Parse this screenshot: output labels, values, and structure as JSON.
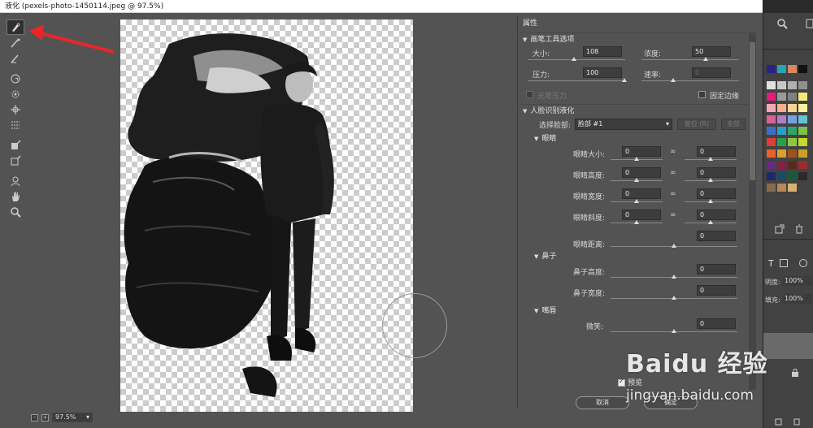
{
  "window": {
    "title": "液化 (pexels-photo-1450114.jpeg @ 97.5%)"
  },
  "toolbar": {
    "tools": [
      {
        "name": "forward-warp-tool-icon",
        "active": true
      },
      {
        "name": "reconstruct-tool-icon"
      },
      {
        "name": "smooth-tool-icon"
      },
      {
        "name": "twirl-tool-icon"
      },
      {
        "name": "pucker-tool-icon"
      },
      {
        "name": "bloat-tool-icon"
      },
      {
        "name": "push-left-tool-icon"
      },
      {
        "name": "freeze-mask-tool-icon"
      },
      {
        "name": "thaw-mask-tool-icon"
      },
      {
        "name": "face-tool-icon"
      },
      {
        "name": "hand-tool-icon"
      },
      {
        "name": "zoom-tool-icon"
      }
    ]
  },
  "status": {
    "zoom": "97.5%",
    "minus": "-",
    "plus": "+"
  },
  "panel": {
    "title": "属性",
    "brush": {
      "heading": "画笔工具选项",
      "size_label": "大小:",
      "size_value": "108",
      "density_label": "浓度:",
      "density_value": "50",
      "pressure_label": "压力:",
      "pressure_value": "100",
      "rate_label": "速率:",
      "rate_value": "0",
      "stylus_label": "光笔压力",
      "pin_edges_label": "固定边缘"
    },
    "face": {
      "heading": "人脸识别液化",
      "select_face_label": "选择脸部:",
      "select_face_value": "脸部 #1",
      "reset_label": "复位 (R)",
      "all_label": "全部",
      "eyes": {
        "heading": "眼睛",
        "eye_size_label": "眼睛大小:",
        "eye_size_left": "0",
        "eye_size_right": "0",
        "eye_height_label": "眼睛高度:",
        "eye_height_left": "0",
        "eye_height_right": "0",
        "eye_width_label": "眼睛宽度:",
        "eye_width_left": "0",
        "eye_width_right": "0",
        "eye_tilt_label": "眼睛斜度:",
        "eye_tilt_left": "0",
        "eye_tilt_right": "0",
        "eye_distance_label": "眼睛距离:",
        "eye_distance_value": "0"
      },
      "nose": {
        "heading": "鼻子",
        "nose_height_label": "鼻子高度:",
        "nose_height_value": "0",
        "nose_width_label": "鼻子宽度:",
        "nose_width_value": "0"
      },
      "mouth": {
        "heading": "嘴唇",
        "smile_label": "微笑:",
        "smile_value": "0"
      }
    },
    "preview_label": "预览",
    "cancel_label": "取消",
    "ok_label": "确定"
  },
  "watermark": {
    "logo": "Baidu 经验",
    "url": "jingyan.baidu.com"
  },
  "background_app": {
    "opacity_label": "明度:",
    "opacity_value": "100%",
    "fill_label": "填充:",
    "fill_value": "100%"
  },
  "colors": {
    "accent_red": "#e8262a",
    "panel_bg": "#535353"
  }
}
